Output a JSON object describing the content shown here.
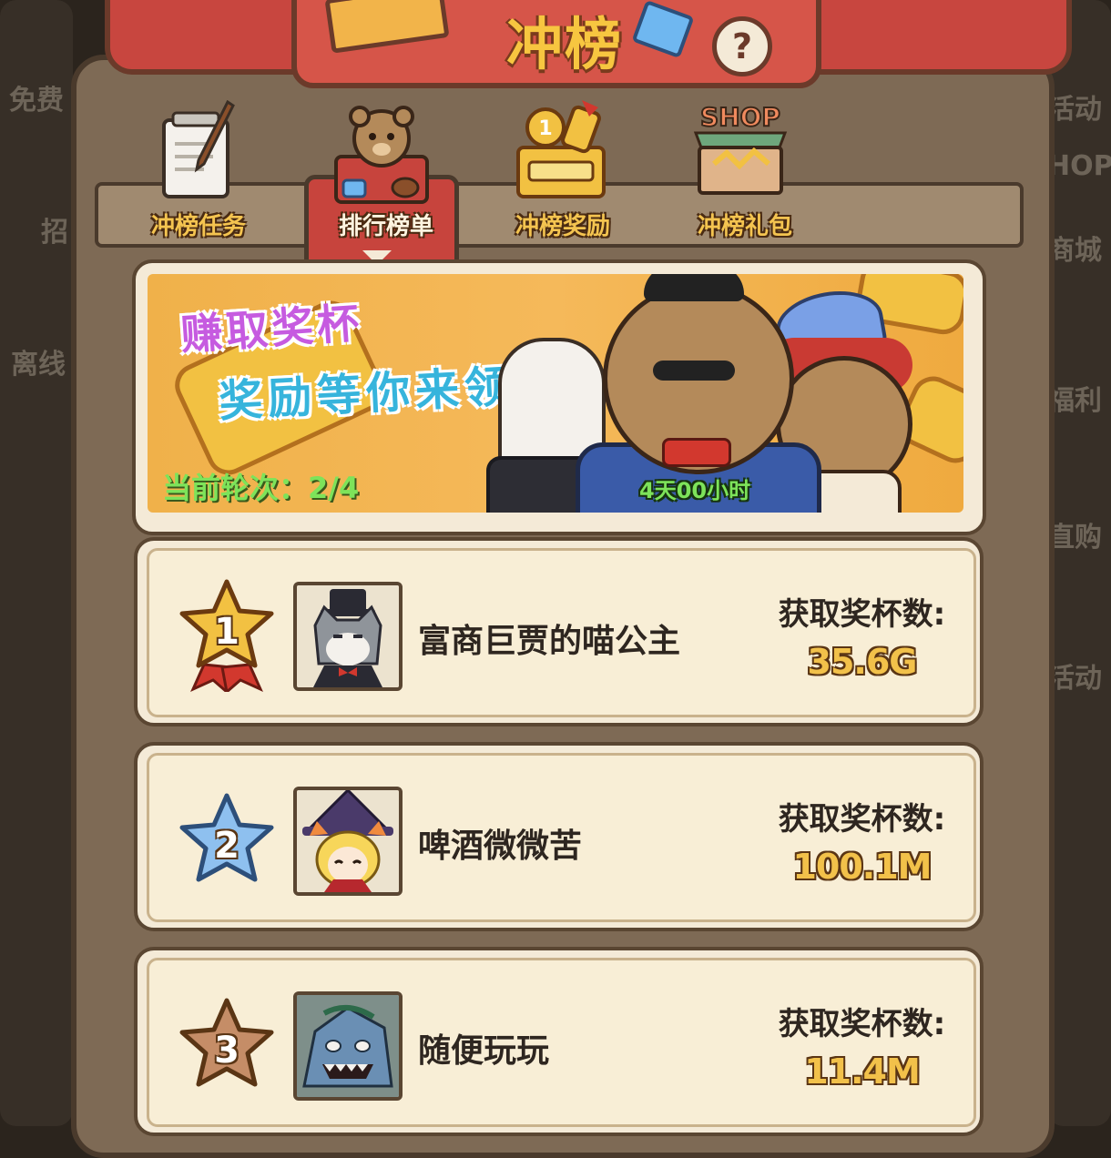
{
  "header": {
    "title": "冲榜",
    "help_label": "?"
  },
  "tabs": [
    {
      "label": "冲榜任务",
      "icon": "quest-scroll-icon"
    },
    {
      "label": "排行榜单",
      "icon": "bear-chest-icon",
      "active": true
    },
    {
      "label": "冲榜奖励",
      "icon": "trophy-chest-icon"
    },
    {
      "label": "冲榜礼包",
      "icon": "shop-icon",
      "icon_text": "SHOP"
    }
  ],
  "banner": {
    "line1": "赚取奖杯",
    "line2": "奖励等你来领",
    "round_label": "当前轮次：",
    "round_value": "2/4",
    "timer": "4天00小时"
  },
  "ranking": [
    {
      "rank": "1",
      "name": "富商巨贾的喵公主",
      "score_label": "获取奖杯数:",
      "score": "35.6G",
      "medal_color": "#f2c142"
    },
    {
      "rank": "2",
      "name": "啤酒微微苦",
      "score_label": "获取奖杯数:",
      "score": "100.1M",
      "medal_color": "#8ec0ef"
    },
    {
      "rank": "3",
      "name": "随便玩玩",
      "score_label": "获取奖杯数:",
      "score": "11.4M",
      "medal_color": "#c58d67"
    }
  ],
  "background_labels": {
    "left": [
      "免费",
      "招",
      "离线"
    ],
    "right": [
      "活动",
      "HOP",
      "商城",
      "福利",
      "直购",
      "活动"
    ]
  }
}
